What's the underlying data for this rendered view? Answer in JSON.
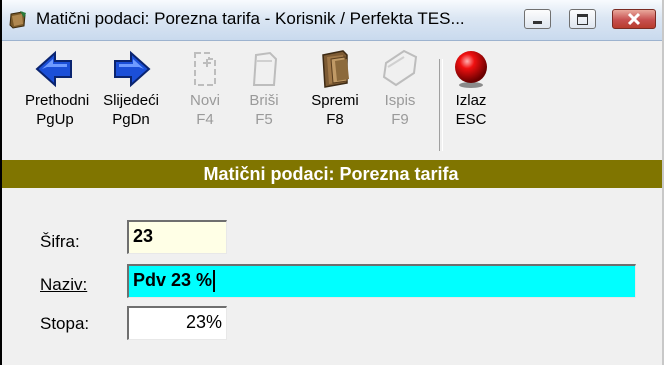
{
  "window": {
    "title": "Matični podaci: Porezna tarifa - Korisnik / Perfekta TES..."
  },
  "toolbar": {
    "items": [
      {
        "line1": "Prethodni",
        "line2": "PgUp",
        "icon": "arrow-left-icon",
        "enabled": true
      },
      {
        "line1": "Slijedeći",
        "line2": "PgDn",
        "icon": "arrow-right-icon",
        "enabled": true
      },
      {
        "line1": "Novi",
        "line2": "F4",
        "icon": "new-record-icon",
        "enabled": false
      },
      {
        "line1": "Briši",
        "line2": "F5",
        "icon": "delete-record-icon",
        "enabled": false
      },
      {
        "line1": "Spremi",
        "line2": "F8",
        "icon": "save-folders-icon",
        "enabled": true
      },
      {
        "line1": "Ispis",
        "line2": "F9",
        "icon": "print-icon",
        "enabled": false
      },
      {
        "line1": "Izlaz",
        "line2": "ESC",
        "icon": "exit-red-ball-icon",
        "enabled": true
      }
    ]
  },
  "header": {
    "title": "Matični podaci: Porezna tarifa"
  },
  "form": {
    "sifra": {
      "label": "Šifra:",
      "value": "23"
    },
    "naziv": {
      "label": "Naziv:",
      "value": "Pdv 23 %"
    },
    "stopa": {
      "label": "Stopa:",
      "value": "23%"
    }
  },
  "colors": {
    "header_band": "#807500",
    "sifra_field_bg": "#ffffe6",
    "naziv_field_bg": "#00ffff",
    "stopa_field_bg": "#ffffff",
    "arrow_blue": "#1b4fd8"
  }
}
